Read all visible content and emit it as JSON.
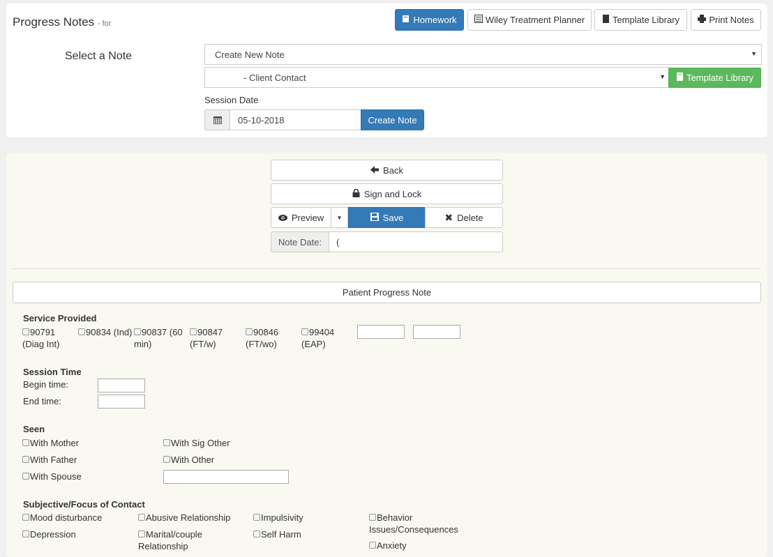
{
  "header": {
    "title": "Progress Notes",
    "subtitle": "- for",
    "buttons": {
      "homework": "Homework",
      "wiley": "Wiley Treatment Planner",
      "template_library": "Template Library",
      "print_notes": "Print Notes"
    }
  },
  "select_note": {
    "label": "Select a Note",
    "note_select_value": "Create New Note",
    "template_select_value": "- Client Contact",
    "template_library_button": "Template Library",
    "session_date_label": "Session Date",
    "session_date_value": "05-10-2018",
    "create_note_button": "Create Note"
  },
  "actions": {
    "back": "Back",
    "sign_lock": "Sign and Lock",
    "preview": "Preview",
    "save": "Save",
    "delete": "Delete",
    "note_date_label": "Note Date:",
    "note_date_value": "("
  },
  "form": {
    "title": "Patient Progress Note",
    "service_provided": {
      "heading": "Service Provided",
      "options": [
        {
          "line1": "90791",
          "line2": "(Diag Int)"
        },
        {
          "line1": "90834 (Ind)",
          "line2": ""
        },
        {
          "line1": "90837 (60",
          "line2": "min)"
        },
        {
          "line1": "90847",
          "line2": "(FT/w)"
        },
        {
          "line1": "90846",
          "line2": "(FT/wo)"
        },
        {
          "line1": "99404",
          "line2": "(EAP)"
        }
      ]
    },
    "session_time": {
      "heading": "Session Time",
      "begin_label": "Begin time:",
      "end_label": "End time:"
    },
    "seen": {
      "heading": "Seen",
      "options": [
        "With Mother",
        "With Father",
        "With Spouse",
        "With Sig Other",
        "With Other"
      ]
    },
    "subjective": {
      "heading": "Subjective/Focus of Contact",
      "options": [
        {
          "line1": "Mood disturbance",
          "line2": ""
        },
        {
          "line1": "Depression",
          "line2": ""
        },
        {
          "line1": "Abusive Relationship",
          "line2": ""
        },
        {
          "line1": "Marital/couple",
          "line2": "Relationship"
        },
        {
          "line1": "Impulsivity",
          "line2": ""
        },
        {
          "line1": "Self Harm",
          "line2": ""
        },
        {
          "line1": "Behavior",
          "line2": "Issues/Consequences"
        },
        {
          "line1": "Anxiety",
          "line2": ""
        }
      ]
    }
  },
  "colors": {
    "primary": "#337ab7",
    "success": "#5cb85c",
    "panel_bg": "#f9f8f1",
    "page_bg": "#f0f0f0"
  },
  "icons": {
    "homework": "book-icon",
    "wiley": "list-icon",
    "template_library": "book-icon",
    "print": "print-icon",
    "calendar": "calendar-icon",
    "back": "arrow-left-icon",
    "sign": "lock-icon",
    "preview": "eye-icon",
    "save": "floppy-icon",
    "delete": "x-icon"
  }
}
